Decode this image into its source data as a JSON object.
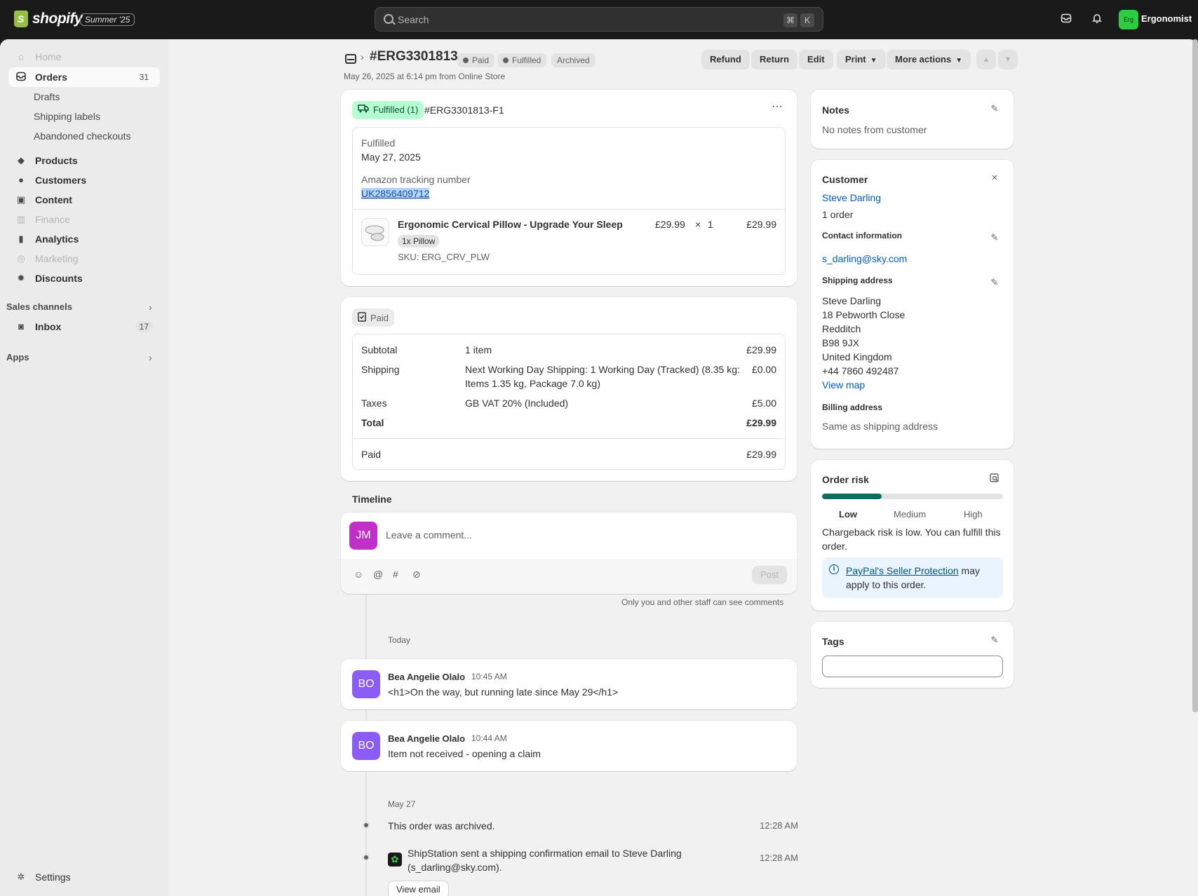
{
  "topbar": {
    "logo_text": "shopify",
    "edition_badge": "Summer '25",
    "search_placeholder": "Search",
    "search_kbd_1": "⌘",
    "search_kbd_2": "K",
    "store_avatar": "Erg",
    "store_name": "Ergonomist"
  },
  "sidebar": {
    "home": "Home",
    "orders": "Orders",
    "orders_count": "31",
    "drafts": "Drafts",
    "shipping_labels": "Shipping labels",
    "abandoned_checkouts": "Abandoned checkouts",
    "products": "Products",
    "customers": "Customers",
    "content": "Content",
    "finance": "Finance",
    "analytics": "Analytics",
    "marketing": "Marketing",
    "discounts": "Discounts",
    "sales_channels": "Sales channels",
    "inbox": "Inbox",
    "inbox_count": "17",
    "apps": "Apps",
    "settings": "Settings"
  },
  "header": {
    "order_number": "#ERG3301813",
    "badge_paid": "Paid",
    "badge_fulfilled": "Fulfilled",
    "badge_archived": "Archived",
    "subtitle": "May 26, 2025 at 6:14 pm from Online Store",
    "refund": "Refund",
    "return": "Return",
    "edit": "Edit",
    "print": "Print",
    "more_actions": "More actions"
  },
  "fulfillment": {
    "status_label": "Fulfilled (1)",
    "fulfillment_id": "#ERG3301813-F1",
    "fulfilled_label": "Fulfilled",
    "fulfilled_date": "May 27, 2025",
    "tracking_label": "Amazon tracking number",
    "tracking_number": "UK2856409712",
    "product_name": "Ergonomic Cervical Pillow - Upgrade Your Sleep",
    "variant": "1x Pillow",
    "sku": "SKU: ERG_CRV_PLW",
    "unit_price": "£29.99",
    "times": "×",
    "quantity": "1",
    "line_total": "£29.99"
  },
  "payment": {
    "status_label": "Paid",
    "subtotal_label": "Subtotal",
    "subtotal_desc": "1 item",
    "subtotal_value": "£29.99",
    "shipping_label": "Shipping",
    "shipping_desc_1": "Next Working Day Shipping: 1 Working Day (Tracked) (8.35 kg:",
    "shipping_desc_2": "Items 1.35 kg, Package 7.0 kg)",
    "shipping_value": "£0.00",
    "taxes_label": "Taxes",
    "taxes_desc": "GB VAT 20% (Included)",
    "taxes_value": "£5.00",
    "total_label": "Total",
    "total_value": "£29.99",
    "paid_label": "Paid",
    "paid_value": "£29.99"
  },
  "timeline": {
    "title": "Timeline",
    "commenter_initials": "JM",
    "comment_placeholder": "Leave a comment...",
    "post_button": "Post",
    "staff_note": "Only you and other staff can see comments",
    "today_label": "Today",
    "comments": [
      {
        "initials": "BO",
        "author": "Bea Angelie Olalo",
        "time": "10:45 AM",
        "text": "<h1>On the way, but running late since May 29</h1>"
      },
      {
        "initials": "BO",
        "author": "Bea Angelie Olalo",
        "time": "10:44 AM",
        "text": "Item not received - opening a claim"
      }
    ],
    "may27_label": "May 27",
    "events": [
      {
        "text": "This order was archived.",
        "time": "12:28 AM"
      },
      {
        "text_1": "ShipStation sent a shipping confirmation email to Steve Darling",
        "text_2": "(s_darling@sky.com).",
        "time": "12:28 AM",
        "button": "View email"
      }
    ]
  },
  "notes": {
    "title": "Notes",
    "text": "No notes from customer"
  },
  "customer": {
    "title": "Customer",
    "name": "Steve Darling",
    "orders": "1 order",
    "contact_title": "Contact information",
    "email": "s_darling@sky.com",
    "shipping_title": "Shipping address",
    "address": [
      "Steve Darling",
      "18 Pebworth Close",
      "Redditch",
      "B98 9JX",
      "United Kingdom",
      "+44 7860 492487"
    ],
    "view_map": "View map",
    "billing_title": "Billing address",
    "billing_text": "Same as shipping address"
  },
  "risk": {
    "title": "Order risk",
    "level_fraction": 0.33,
    "low": "Low",
    "medium": "Medium",
    "high": "High",
    "message": "Chargeback risk is low. You can fulfill this order.",
    "info_link": "PayPal's Seller Protection",
    "info_text": "may apply to this order."
  },
  "tags": {
    "title": "Tags"
  },
  "colors": {
    "accent_link": "#005bd3",
    "fulfilled_bg": "#b4fed2",
    "risk_fill": "#0f6e5e",
    "avatar_jm": "#c12fc9",
    "avatar_bo": "#8b5cf6"
  }
}
